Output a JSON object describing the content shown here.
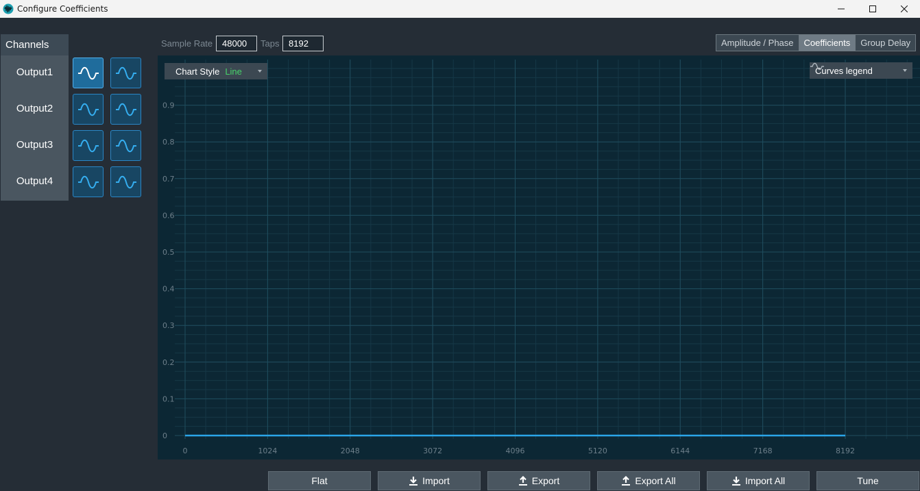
{
  "window": {
    "title": "Configure Coefficients"
  },
  "icons": {
    "app": "waveform-app-icon",
    "minimize": "minimize-icon",
    "maximize": "maximize-icon",
    "close": "close-icon",
    "wave": "sine-wave-icon",
    "import": "download-arrow-icon",
    "export": "upload-arrow-icon",
    "legend": "wave-legend-icon"
  },
  "colors": {
    "accent": "#2a87c7",
    "curve": "#2aa5e8",
    "chart_bg": "#0c2734",
    "style_value": "#47d36a"
  },
  "sidebar": {
    "header": "Channels",
    "channels": [
      {
        "label": "Output1"
      },
      {
        "label": "Output2"
      },
      {
        "label": "Output3"
      },
      {
        "label": "Output4"
      }
    ]
  },
  "top": {
    "sample_rate_label": "Sample Rate",
    "sample_rate_value": "48000",
    "taps_label": "Taps",
    "taps_value": "8192",
    "tabs": [
      {
        "label": "Amplitude / Phase",
        "active": false
      },
      {
        "label": "Coefficients",
        "active": true
      },
      {
        "label": "Group Delay",
        "active": false
      }
    ]
  },
  "chart_controls": {
    "style_label": "Chart Style",
    "style_value": "Line",
    "legend_label": "Curves legend"
  },
  "chart_data": {
    "type": "line",
    "title": "",
    "xlabel": "",
    "ylabel": "",
    "xlim": [
      0,
      8192
    ],
    "ylim": [
      0,
      1
    ],
    "grid": true,
    "x_ticks": [
      0,
      1024,
      2048,
      3072,
      4096,
      5120,
      6144,
      7168,
      8192
    ],
    "y_ticks": [
      0,
      0.1,
      0.2,
      0.3,
      0.4,
      0.5,
      0.6,
      0.7,
      0.8,
      0.9
    ],
    "series": [
      {
        "x": [
          0,
          8192
        ],
        "y": [
          0,
          0
        ]
      }
    ]
  },
  "bottom_buttons": [
    {
      "label": "Flat",
      "icon": ""
    },
    {
      "label": "Import",
      "icon": "download-arrow-icon"
    },
    {
      "label": "Export",
      "icon": "upload-arrow-icon"
    },
    {
      "label": "Export All",
      "icon": "upload-arrow-icon"
    },
    {
      "label": "Import All",
      "icon": "download-arrow-icon"
    },
    {
      "label": "Tune",
      "icon": ""
    }
  ]
}
